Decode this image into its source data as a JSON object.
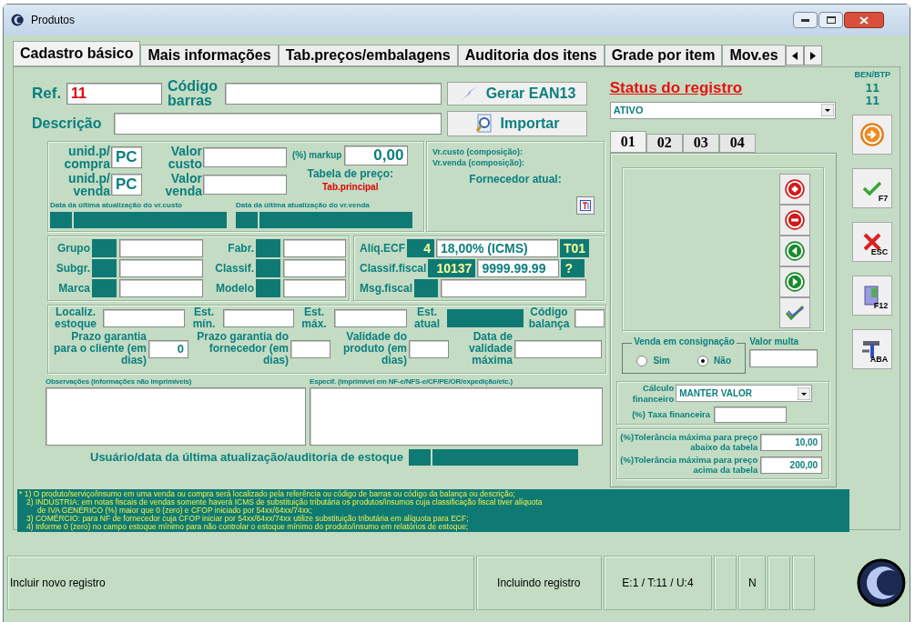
{
  "window": {
    "title": "Produtos"
  },
  "tabs": [
    {
      "label": "Cadastro básico",
      "selected": true
    },
    {
      "label": "Mais informações",
      "selected": false
    },
    {
      "label": "Tab.preços/embalagens",
      "selected": false
    },
    {
      "label": "Auditoria dos itens",
      "selected": false
    },
    {
      "label": "Grade por item",
      "selected": false
    },
    {
      "label": "Mov.es",
      "selected": false
    }
  ],
  "ref": {
    "label": "Ref.",
    "value": "11"
  },
  "barcode": {
    "label": "Código barras"
  },
  "description": {
    "label": "Descrição"
  },
  "actions": [
    {
      "label": "Gerar EAN13",
      "kind": "ean"
    },
    {
      "label": "Importar",
      "kind": "import"
    }
  ],
  "units": [
    {
      "label": "unid.p/ compra",
      "value": "PC"
    },
    {
      "label": "unid.p/ venda",
      "value": "PC"
    }
  ],
  "values": [
    {
      "label": "Valor custo"
    },
    {
      "label": "Valor venda"
    }
  ],
  "markup": {
    "label": "(%) markup",
    "value": "0,00"
  },
  "price_table": {
    "label": "Tabela de preço:",
    "value": "Tab.principal"
  },
  "update_dates": [
    {
      "label": "Data da última atualização do vr.custo"
    },
    {
      "label": "Data da última atualização do vr.venda"
    }
  ],
  "composition": [
    "Vr.custo (composição):",
    "Vr.venda (composição):"
  ],
  "supplier": {
    "label": "Fornecedor atual:"
  },
  "classification_left": [
    {
      "label": "Grupo"
    },
    {
      "label": "Subgr."
    },
    {
      "label": "Marca"
    }
  ],
  "classification_right": [
    {
      "label": "Fabr."
    },
    {
      "label": "Classif."
    },
    {
      "label": "Modelo"
    }
  ],
  "fiscal": [
    {
      "label": "Alíq.ECF",
      "code": "4",
      "value": "18,00% (ICMS)",
      "tag": "T01"
    },
    {
      "label": "Classif.fiscal",
      "code": "10137",
      "value": "9999.99.99",
      "tag": "?"
    },
    {
      "label": "Msg.fiscal"
    }
  ],
  "stock": [
    {
      "label": "Localiz. estoque",
      "kind": "input"
    },
    {
      "label": "Est. mín.",
      "kind": "input"
    },
    {
      "label": "Est. máx.",
      "kind": "input"
    },
    {
      "label": "Est. atual",
      "kind": "readonly"
    },
    {
      "label": "Código balança",
      "kind": "input"
    }
  ],
  "validity": [
    {
      "label": "Prazo garantia para o cliente (em dias)",
      "value": "0"
    },
    {
      "label": "Prazo garantia do fornecedor (em dias)"
    },
    {
      "label": "Validade do produto (em dias)"
    },
    {
      "label": "Data de validade máxima"
    }
  ],
  "notes": [
    {
      "label": "Observações (informações não imprimíveis)"
    },
    {
      "label": "Especif. (imprimível em NF-e/NFS-e/CF/PE/OR/expedição/etc.)"
    }
  ],
  "audit": {
    "label": "Usuário/data da última atualização/auditoria de estoque"
  },
  "status": {
    "label": "Status do registro",
    "value": "ATIVO"
  },
  "ben_btp": {
    "label": "BEN/BTP",
    "values": [
      "11",
      "11"
    ]
  },
  "subtabs": [
    {
      "label": "01",
      "selected": true
    },
    {
      "label": "02",
      "selected": false
    },
    {
      "label": "03",
      "selected": false
    },
    {
      "label": "04",
      "selected": false
    }
  ],
  "list_buttons": [
    {
      "kind": "add"
    },
    {
      "kind": "remove"
    },
    {
      "kind": "prev"
    },
    {
      "kind": "next"
    },
    {
      "kind": "confirm"
    }
  ],
  "consignment": {
    "label": "Venda em consignação",
    "options": [
      {
        "label": "Sim",
        "selected": false
      },
      {
        "label": "Não",
        "selected": true
      }
    ]
  },
  "fine": {
    "label": "Valor multa"
  },
  "financial": {
    "label": "Cálculo financeiro",
    "value": "MANTER VALOR",
    "rate_label": "(%) Taxa financeira"
  },
  "tolerances": [
    {
      "label": "(%)Tolerância máxima para preço abaixo da tabela",
      "value": "10,00"
    },
    {
      "label": "(%)Tolerância máxima para preço acima da tabela",
      "value": "200,00"
    }
  ],
  "side_buttons": [
    {
      "kind": "next"
    },
    {
      "kind": "save",
      "key": "F7"
    },
    {
      "kind": "cancel",
      "key": "ESC"
    },
    {
      "kind": "exit",
      "key": "F12"
    },
    {
      "kind": "tools",
      "key": "ABA"
    }
  ],
  "hints": [
    {
      "kind": "first",
      "text": "* 1) O produto/serviço/insumo em uma venda ou compra será localizado pela referência ou código de barras ou código da balança ou descrição;"
    },
    {
      "kind": "item",
      "text": "2) INDÚSTRIA: em notas fiscais de vendas somente haverá ICMS de substituição tributária os produtos/insumos cuja classificação fiscal tiver alíquota"
    },
    {
      "kind": "continuation",
      "text": "de IVA GENÉRICO (%) maior que 0 (zero) e CFOP iniciado por 54xx/64xx/74xx;"
    },
    {
      "kind": "item",
      "text": "3) COMÉRCIO: para NF de fornecedor cuja CFOP iniciar por 54xx/64xx/74xx utilize substituição tributária em alíquota para ECF;"
    },
    {
      "kind": "item",
      "text": "4) Informe 0 (zero) no campo estoque mínimo para não controlar o estoque mínimo do produto/insumo em relatórios de estoque;"
    }
  ],
  "status_bar": [
    {
      "kind": "text",
      "text": "Incluir  novo  registro"
    },
    {
      "kind": "text",
      "text": "Incluindo registro"
    },
    {
      "kind": "text",
      "text": "E:1 / T:11 / U:4"
    },
    {
      "kind": "blank"
    },
    {
      "kind": "text",
      "text": "N"
    },
    {
      "kind": "blank"
    },
    {
      "kind": "blank"
    }
  ]
}
